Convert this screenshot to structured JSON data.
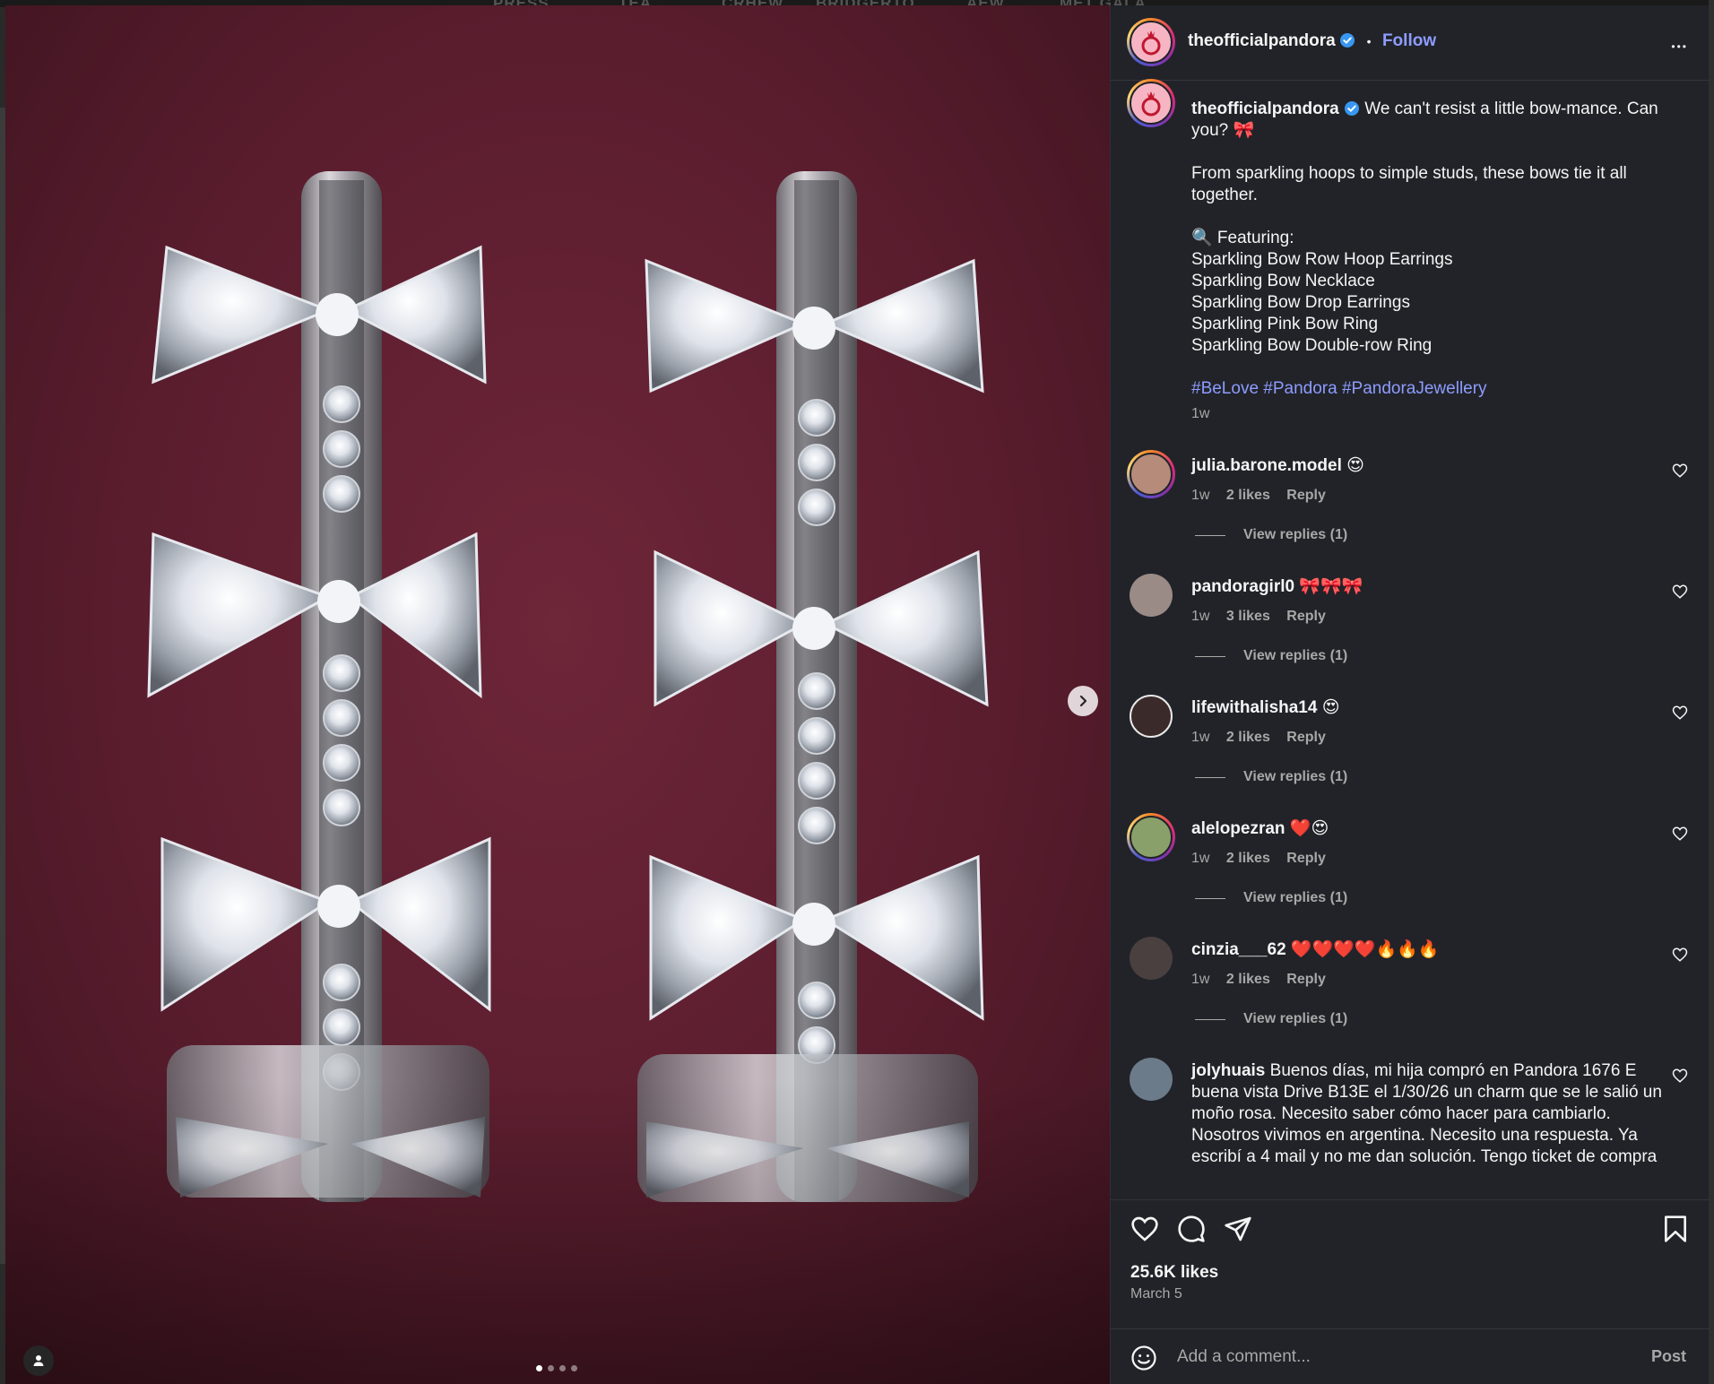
{
  "backdrop": {
    "nav_items": [
      "PRESS",
      "TEA",
      "CRHEW",
      "BRIDGERTO",
      "AEW",
      "MET GALA"
    ]
  },
  "media": {
    "alt_subject": "sparkling bow hoop earrings",
    "carousel": {
      "count": 4,
      "active_index": 0
    }
  },
  "post": {
    "author": "theofficialpandora",
    "follow_label": "Follow",
    "separator": "•",
    "more_label": "•••",
    "caption_line1": "We can't resist a little bow-mance. Can you? 🎀",
    "caption_para2": "From sparkling hoops to simple studs, these bows tie it all together.",
    "featuring_label": "🔍 Featuring:",
    "featured_items": [
      "Sparkling Bow Row Hoop Earrings",
      "Sparkling Bow Necklace",
      "Sparkling Bow Drop Earrings",
      "Sparkling Pink Bow Ring",
      "Sparkling Bow Double-row Ring"
    ],
    "hashtags": "#BeLove #Pandora #PandoraJewellery",
    "caption_time": "1w",
    "likes": "25.6K likes",
    "date": "March 5"
  },
  "comments": [
    {
      "user": "julia.barone.model",
      "text": "😍",
      "time": "1w",
      "likes": "2 likes",
      "reply": "Reply",
      "replies": "View replies (1)",
      "avatar_color": "#b78b7a"
    },
    {
      "user": "pandoragirl0",
      "text": "🎀🎀🎀",
      "time": "1w",
      "likes": "3 likes",
      "reply": "Reply",
      "replies": "View replies (1)",
      "avatar_color": "#9a8b86"
    },
    {
      "user": "lifewithalisha14",
      "text": "😍",
      "time": "1w",
      "likes": "2 likes",
      "reply": "Reply",
      "replies": "View replies (1)",
      "avatar_color": "#3b2a2a"
    },
    {
      "user": "alelopezran",
      "text": "❤️😍",
      "time": "1w",
      "likes": "2 likes",
      "reply": "Reply",
      "replies": "View replies (1)",
      "avatar_color": "#8aa06a"
    },
    {
      "user": "cinzia___62",
      "text": "❤️❤️❤️❤️🔥🔥🔥",
      "time": "1w",
      "likes": "2 likes",
      "reply": "Reply",
      "replies": "View replies (1)",
      "avatar_color": "#4a4040"
    },
    {
      "user": "jolyhuais",
      "text": "Buenos días, mi hija compró en Pandora 1676 E buena vista Drive B13E el 1/30/26 un charm que se le salió un moño rosa. Necesito saber cómo hacer para cambiarlo. Nosotros vivimos en argentina. Necesito una respuesta. Ya escribí a 4 mail y no me dan solución. Tengo ticket de compra",
      "avatar_color": "#6b7b8a"
    }
  ],
  "comment_input": {
    "placeholder": "Add a comment...",
    "post_label": "Post"
  },
  "colors": {
    "panel_bg": "#212328",
    "link_blue": "#8e9cff",
    "muted": "#a8a8a8",
    "verified_blue": "#3897f0"
  },
  "icons": [
    "heart-icon",
    "comment-icon",
    "share-icon",
    "bookmark-icon",
    "emoji-icon",
    "chevron-right-icon",
    "user-tag-icon",
    "verified-icon",
    "more-icon"
  ]
}
